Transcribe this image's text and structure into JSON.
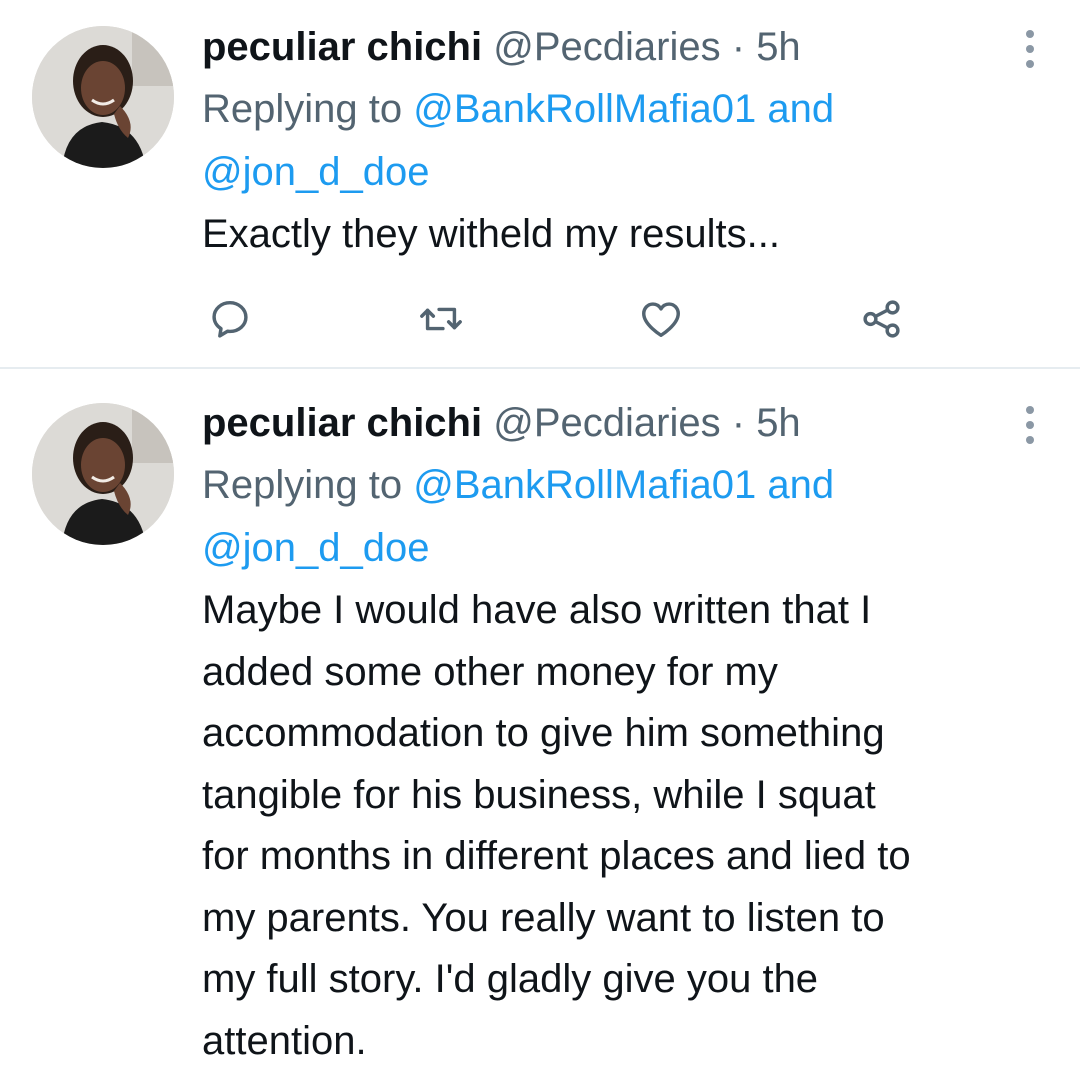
{
  "tweets": [
    {
      "author": {
        "name": "peculiar chichi",
        "handle": "@Pecdiaries",
        "separator": "·",
        "time": "5h"
      },
      "reply": {
        "prefix": "Replying to",
        "mention_1": "@BankRollMafia01",
        "conjunction": "and",
        "mention_2": "@jon_d_doe"
      },
      "text": "Exactly they witheld my results...",
      "actions": [
        "reply-icon",
        "retweet-icon",
        "like-icon",
        "share-icon"
      ]
    },
    {
      "author": {
        "name": "peculiar chichi",
        "handle": "@Pecdiaries",
        "separator": "·",
        "time": "5h"
      },
      "reply": {
        "prefix": "Replying to",
        "mention_1": "@BankRollMafia01",
        "conjunction": "and",
        "mention_2": "@jon_d_doe"
      },
      "text_lines": [
        "Maybe I would have also written that I",
        "added some other money for my",
        "accommodation to give him something",
        "tangible for his business, while I squat",
        "for months in different places and lied to",
        "my parents. You really want to listen to",
        "my full story. I'd gladly give you the",
        "attention."
      ]
    }
  ],
  "colors": {
    "text": "#0f1419",
    "secondary": "#536471",
    "link": "#1d9bf0",
    "icon": "#536471",
    "divider": "#e6ecf0"
  }
}
